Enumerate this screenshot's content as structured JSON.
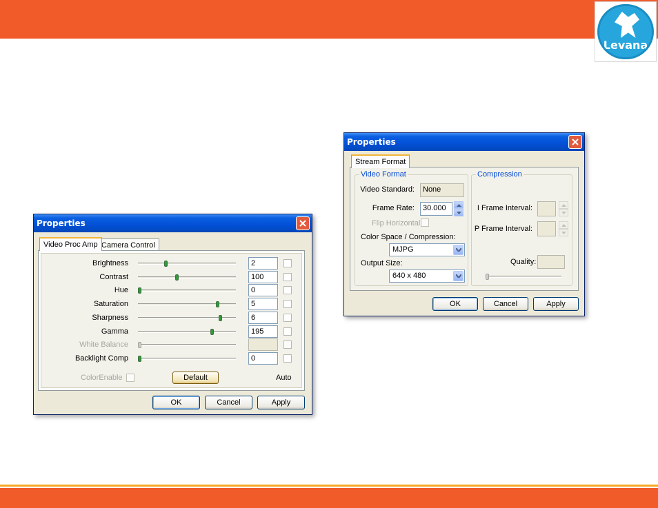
{
  "slide": {
    "logo_text": "Levana",
    "colors": {
      "bar": "#f15b2a",
      "bar_accent": "#f7a824",
      "logo_blue": "#27a6dd"
    }
  },
  "left_dialog": {
    "title": "Properties",
    "close_icon": "close-icon",
    "tabs": [
      {
        "label": "Video Proc Amp",
        "active": true
      },
      {
        "label": "Camera Control",
        "active": false
      }
    ],
    "rows": [
      {
        "label": "Brightness",
        "value": "2",
        "level": 0.28,
        "enabled": true
      },
      {
        "label": "Contrast",
        "value": "100",
        "level": 0.4,
        "enabled": true
      },
      {
        "label": "Hue",
        "value": "0",
        "level": 0.0,
        "enabled": true
      },
      {
        "label": "Saturation",
        "value": "5",
        "level": 0.83,
        "enabled": true
      },
      {
        "label": "Sharpness",
        "value": "6",
        "level": 0.86,
        "enabled": true
      },
      {
        "label": "Gamma",
        "value": "195",
        "level": 0.77,
        "enabled": true
      },
      {
        "label": "White Balance",
        "value": "",
        "level": 0.0,
        "enabled": false
      },
      {
        "label": "Backlight Comp",
        "value": "0",
        "level": 0.0,
        "enabled": true
      }
    ],
    "color_enable_label": "ColorEnable",
    "default_label": "Default",
    "auto_label": "Auto",
    "buttons": {
      "ok": "OK",
      "cancel": "Cancel",
      "apply": "Apply"
    }
  },
  "right_dialog": {
    "title": "Properties",
    "tab_label": "Stream Format",
    "video_format": {
      "group_title": "Video Format",
      "video_standard_label": "Video Standard:",
      "video_standard_value": "None",
      "frame_rate_label": "Frame Rate:",
      "frame_rate_value": "30.000",
      "flip_horizontal_label": "Flip Horizontal:",
      "color_space_label": "Color Space / Compression:",
      "color_space_value": "MJPG",
      "output_size_label": "Output Size:",
      "output_size_value": "640 x 480"
    },
    "compression": {
      "group_title": "Compression",
      "i_frame_label": "I Frame Interval:",
      "p_frame_label": "P Frame Interval:",
      "quality_label": "Quality:"
    },
    "buttons": {
      "ok": "OK",
      "cancel": "Cancel",
      "apply": "Apply"
    }
  }
}
